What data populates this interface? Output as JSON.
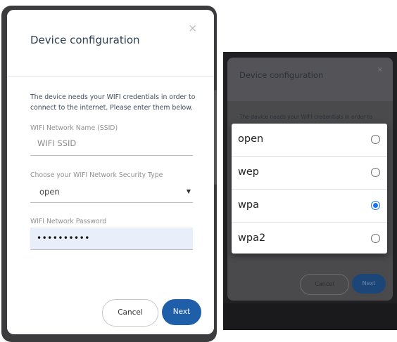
{
  "left": {
    "title": "Device configuration",
    "close": "×",
    "description": "The device needs your WIFI credentials in order to connect to the internet. Please enter them below.",
    "ssid_label": "WIFI Network Name (SSID)",
    "ssid_placeholder": "WIFI SSID",
    "security_label": "Choose your WIFI Network Security Type",
    "security_value": "open",
    "password_label": "WIFI Network Password",
    "password_value": "••••••••••",
    "cancel": "Cancel",
    "next": "Next"
  },
  "right": {
    "title": "Device configuration",
    "close": "×",
    "description": "The device needs your WIFI credentials in order to",
    "cancel": "Cancel",
    "next": "Next",
    "options": [
      {
        "label": "open",
        "checked": false
      },
      {
        "label": "wep",
        "checked": false
      },
      {
        "label": "wpa",
        "checked": true
      },
      {
        "label": "wpa2",
        "checked": false
      }
    ]
  },
  "colors": {
    "primary": "#1f5ea8",
    "radio_checked": "#1a73e8",
    "password_bg": "#e8effb"
  }
}
